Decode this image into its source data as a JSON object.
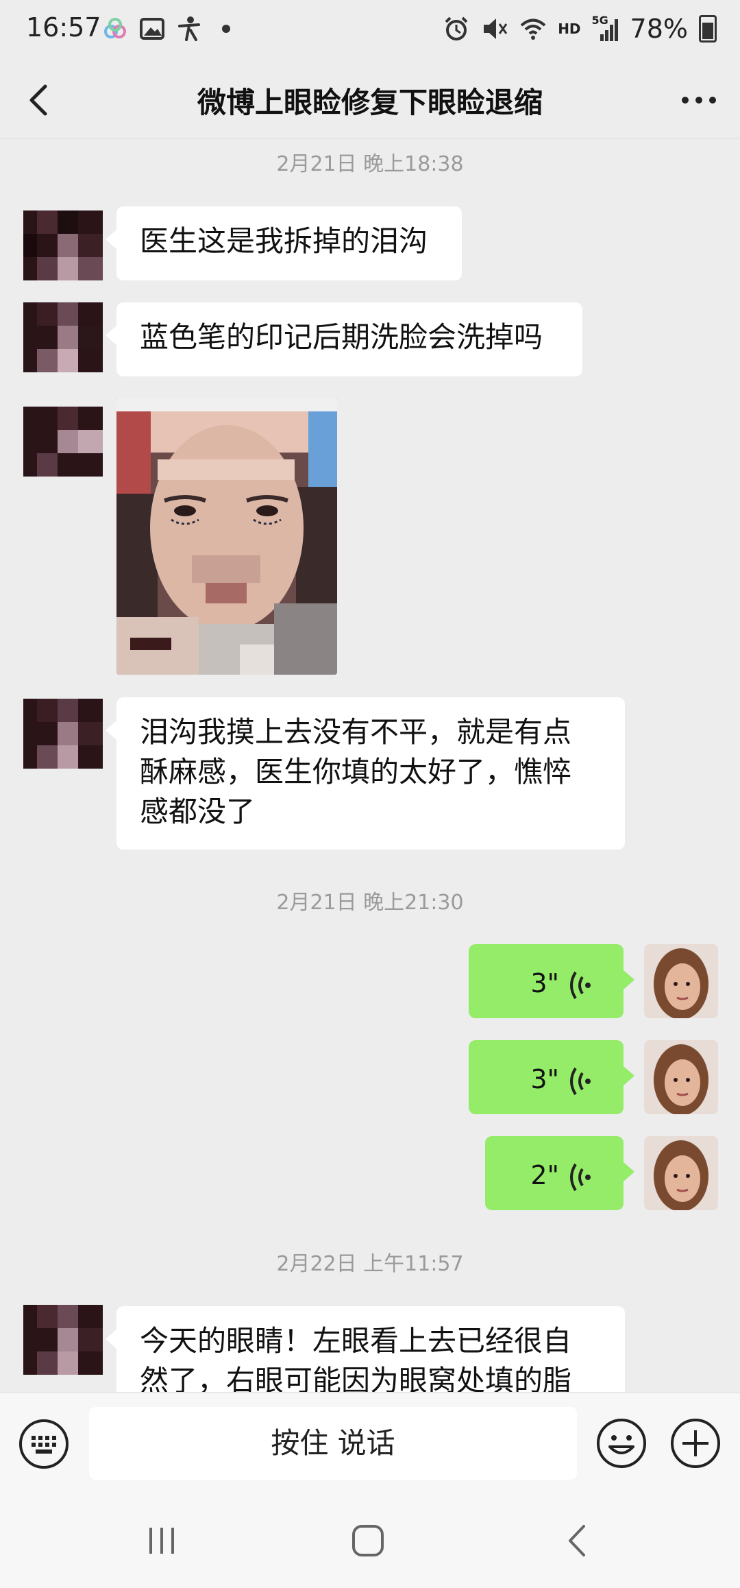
{
  "status_bar": {
    "time": "16:57",
    "network": "HD",
    "signal": "5G",
    "battery": "78%",
    "left_icons": [
      "cloud-app-icon",
      "gallery-icon",
      "accessibility-icon",
      "dot-icon"
    ],
    "right_icons": [
      "alarm-icon",
      "mute-icon",
      "wifi-icon",
      "signal-icon",
      "battery-icon"
    ]
  },
  "header": {
    "title": "微博上眼睑修复下眼睑退缩",
    "back_icon": "chevron-left-icon",
    "more_icon": "more-dots-icon"
  },
  "messages": {
    "timestamp_1": "2月21日 晚上18:38",
    "msg_1": "医生这是我拆掉的泪沟",
    "msg_2": "蓝色笔的印记后期洗脸会洗掉吗",
    "msg_4_line1": "泪沟我摸上去没有不平，就是有点",
    "msg_4_line2": "酥麻感，医生你填的太好了，憔悴",
    "msg_4_line3": "感都没了",
    "timestamp_2": "2月21日 晚上21:30",
    "voice_1": "3\"",
    "voice_2": "3\"",
    "voice_3": "2\"",
    "timestamp_3": "2月22日 上午11:57",
    "msg_5_line1": "今天的眼睛！左眼看上去已经很自",
    "msg_5_line2": "然了，右眼可能因为眼窝处填的脂"
  },
  "input_bar": {
    "talk_label": "按住 说话",
    "keyboard_icon": "keyboard-icon",
    "emoji_icon": "emoji-icon",
    "plus_icon": "plus-icon"
  },
  "colors": {
    "background": "#ededed",
    "outgoing_bubble": "#95ec69",
    "incoming_bubble": "#ffffff",
    "timestamp_text": "#9a9a9a"
  }
}
